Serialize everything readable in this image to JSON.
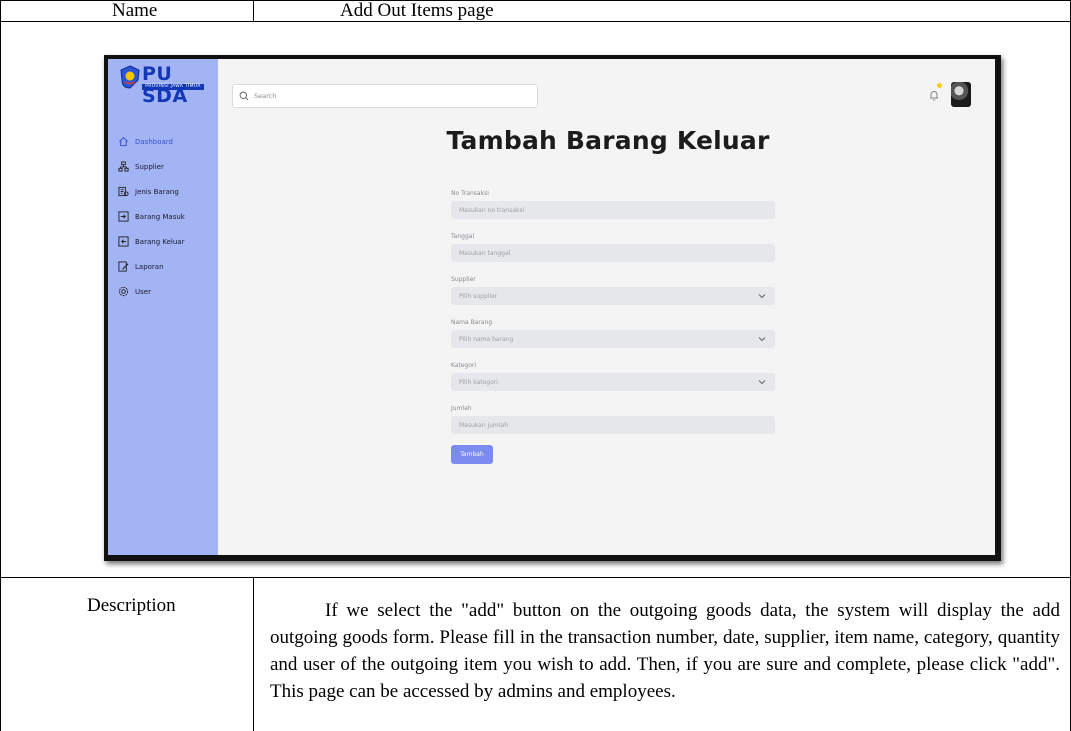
{
  "doc": {
    "name_label": "Name",
    "name_value": "Add Out Items page",
    "description_label": "Description",
    "description_text": "If we select the \"add\" button on the outgoing goods data, the system will display the add outgoing goods form. Please fill in the transaction number, date, supplier, item name, category, quantity and user of the outgoing item you wish to add. Then, if you are sure and complete, please click \"add\". This page can be accessed by admins and employees."
  },
  "app": {
    "logo_text": "PU SDA",
    "logo_subtext": "PROVINSI JAWA TIMUR",
    "search_placeholder": "Search",
    "page_title": "Tambah Barang Keluar",
    "colors": {
      "sidebar": "#a3b4f4",
      "accent": "#7b8cf1",
      "active_nav": "#3451d1",
      "notification": "#f2d100"
    }
  },
  "sidebar": {
    "items": [
      {
        "label": "Dashboard",
        "icon": "home-icon",
        "active": true
      },
      {
        "label": "Supplier",
        "icon": "supplier-icon",
        "active": false
      },
      {
        "label": "Jenis Barang",
        "icon": "item-type-icon",
        "active": false
      },
      {
        "label": "Barang Masuk",
        "icon": "login-icon",
        "active": false
      },
      {
        "label": "Barang Keluar",
        "icon": "logout-icon",
        "active": false
      },
      {
        "label": "Laporan",
        "icon": "report-icon",
        "active": false
      },
      {
        "label": "User",
        "icon": "user-gear-icon",
        "active": false
      }
    ]
  },
  "form": {
    "fields": [
      {
        "label": "No Transaksi",
        "placeholder": "Masukan no transaksi",
        "type": "input"
      },
      {
        "label": "Tanggal",
        "placeholder": "Masukan tanggal",
        "type": "input"
      },
      {
        "label": "Supplier",
        "placeholder": "Pilih supplier",
        "type": "select"
      },
      {
        "label": "Nama Barang",
        "placeholder": "Pilih nama barang",
        "type": "select"
      },
      {
        "label": "Kategori",
        "placeholder": "Pilih kategori",
        "type": "select"
      },
      {
        "label": "Jumlah",
        "placeholder": "Masukan jumlah",
        "type": "input"
      }
    ],
    "submit_label": "Tambah"
  }
}
